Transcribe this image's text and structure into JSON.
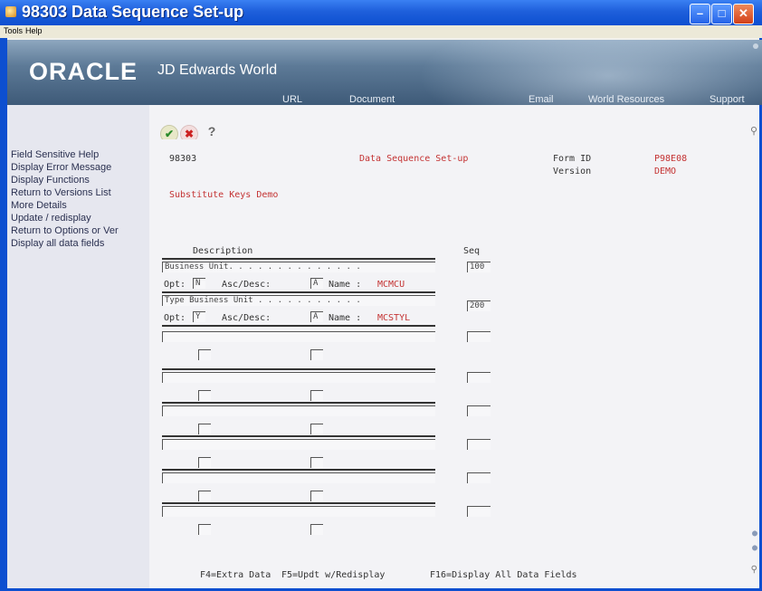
{
  "window": {
    "title": "98303   Data Sequence Set-up",
    "minimize": "–",
    "maximize": "□",
    "close": "✕"
  },
  "menu": {
    "tools": "Tools",
    "help": "Help"
  },
  "banner": {
    "logo": "ORACLE",
    "product": "JD Edwards World",
    "nav": [
      "URL",
      "Document",
      "Email",
      "World Resources",
      "Support"
    ]
  },
  "sidebar": {
    "items": [
      "Field Sensitive Help",
      "Display Error Message",
      "Display Functions",
      "Return to Versions List",
      "More Details",
      "Update / redisplay",
      "Return to Options or Ver",
      "Display all data fields"
    ]
  },
  "toolbar": {
    "ok": "✔",
    "cancel": "✖",
    "help": "?"
  },
  "form": {
    "program": "98303",
    "title": "Data Sequence Set-up",
    "form_id_label": "Form ID",
    "form_id": "P98E08",
    "version_label": "Version",
    "version": "DEMO",
    "subtitle": "Substitute Keys Demo",
    "col_description": "Description",
    "col_seq": "Seq",
    "opt_label": "Opt:",
    "ascdesc_label": "Asc/Desc:",
    "name_label": "Name :",
    "rows": [
      {
        "description": "Business Unit. . . . . . . . . . . . . .",
        "seq": "100",
        "opt": "N",
        "ascdesc": "A",
        "name": "MCMCU"
      },
      {
        "description": "Type Business Unit . . . . . . . . . . .",
        "seq": "200",
        "opt": "Y",
        "ascdesc": "A",
        "name": "MCSTYL"
      }
    ],
    "function_keys": [
      "F4=Extra Data",
      "F5=Updt w/Redisplay",
      "F16=Display All Data Fields"
    ]
  }
}
